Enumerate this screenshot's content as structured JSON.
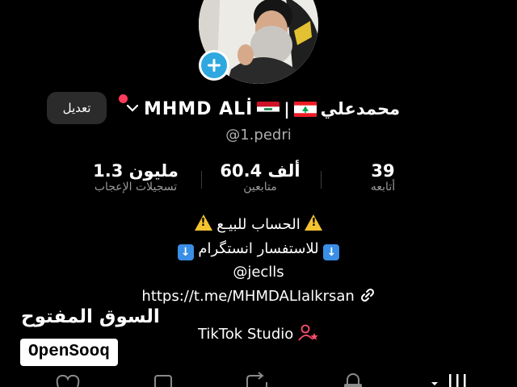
{
  "profile": {
    "display_name_latin": "MHMD ALİ",
    "display_name_arabic": "محمدعلي",
    "username": "@1.pedri",
    "edit_label": "تعديل"
  },
  "stats": [
    {
      "value": "39",
      "label": "أتابعه"
    },
    {
      "value": "60.4 ألف",
      "label": "متابعين"
    },
    {
      "value": "1.3 مليون",
      "label": "تسجيلات الإعجاب"
    }
  ],
  "bio": {
    "line1": "الحساب للبيـع",
    "line2": "للاستفسار انستگرام",
    "line3": "@jeclls",
    "link": "https://t.me/MHMDALIalkrsan",
    "studio": "TikTok Studio"
  },
  "watermark": {
    "arabic": "السوق المفتوح",
    "english": "OpenSooq"
  },
  "colors": {
    "background": "#000000",
    "accent_blue": "#2fa8e0",
    "notification_red": "#ff3b5c",
    "warning_yellow": "#f4c430"
  },
  "icons": [
    "add-icon",
    "chevron-down-icon",
    "link-icon",
    "add-person-icon",
    "warning-icon",
    "down-arrow-icon",
    "heart-icon",
    "bookmark-icon",
    "repost-icon",
    "lock-icon",
    "grid-icon"
  ]
}
